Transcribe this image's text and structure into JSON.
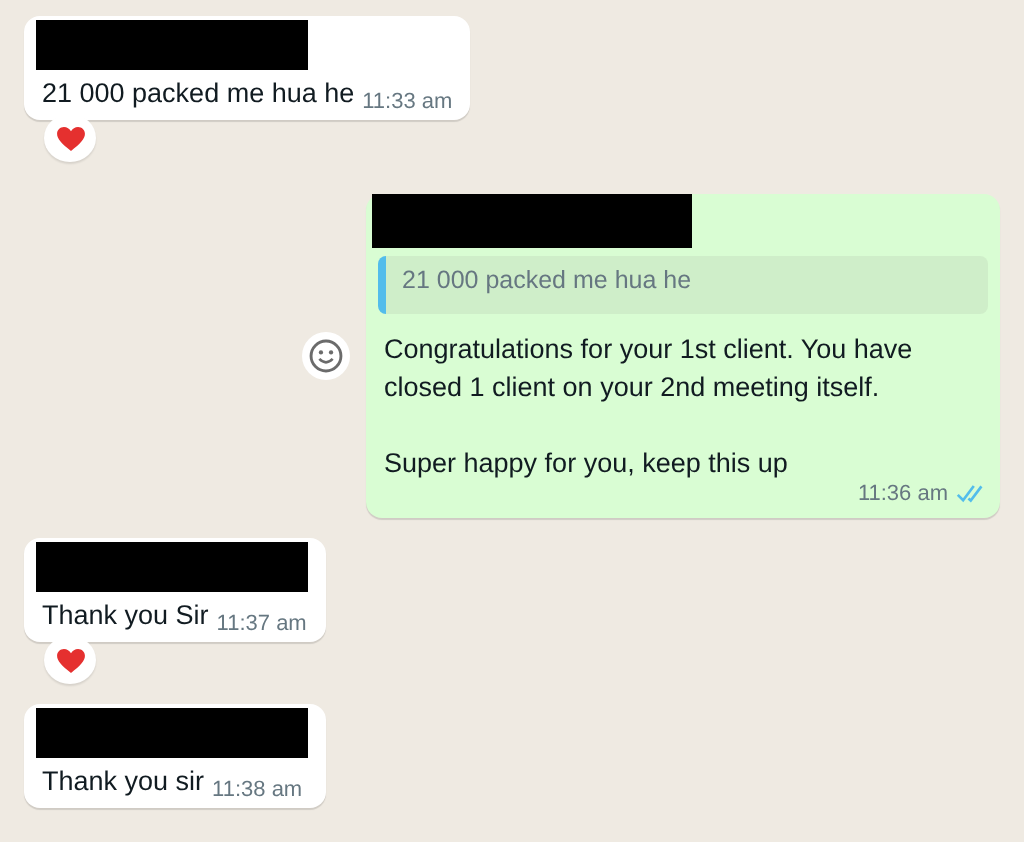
{
  "messages": [
    {
      "kind": "incoming",
      "sender_redacted": true,
      "text": "21 000 packed me hua he",
      "time": "11:33 am",
      "reaction": true
    },
    {
      "kind": "outgoing",
      "sender_redacted": true,
      "quote": "21 000 packed me hua he",
      "text": "Congratulations for your 1st client. You have\nclosed 1 client on your 2nd meeting itself.\n\nSuper happy for you, keep this up",
      "time": "11:36 am",
      "read": true,
      "emoji_button": true
    },
    {
      "kind": "incoming",
      "sender_redacted": true,
      "text": "Thank you Sir",
      "time": "11:37 am",
      "reaction": true
    },
    {
      "kind": "incoming",
      "sender_redacted": true,
      "text": "Thank you sir",
      "time": "11:38 am",
      "reaction": false
    }
  ]
}
